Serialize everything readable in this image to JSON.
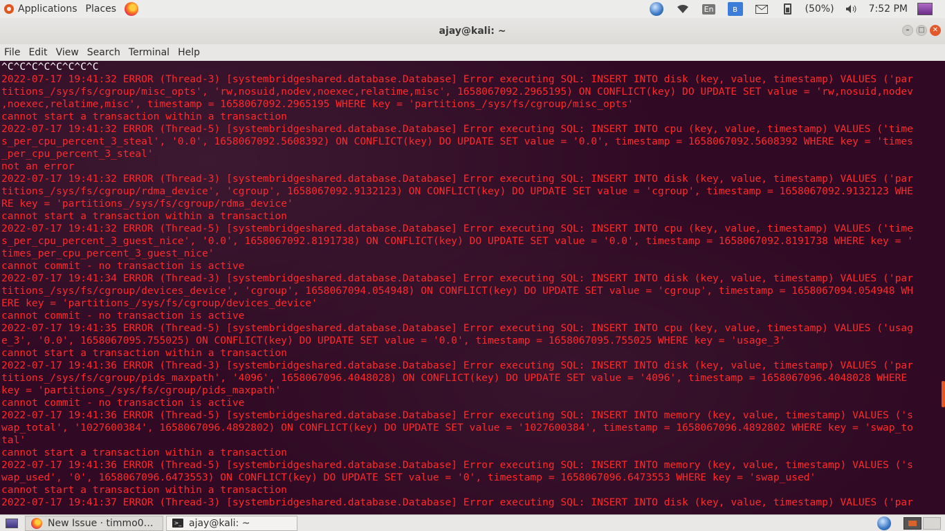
{
  "top_panel": {
    "applications": "Applications",
    "places": "Places",
    "lang": "En",
    "battery": "(50%)",
    "clock": "7:52 PM"
  },
  "window": {
    "title": "ajay@kali: ~"
  },
  "menu": [
    "File",
    "Edit",
    "View",
    "Search",
    "Terminal",
    "Help"
  ],
  "terminal": {
    "lines": [
      {
        "text": "^C^C^C^C^C^C^C^C",
        "color": "white"
      },
      {
        "text": "2022-07-17 19:41:32 ERROR (Thread-3) [systembridgeshared.database.Database] Error executing SQL: INSERT INTO disk (key, value, timestamp) VALUES ('par",
        "color": "red"
      },
      {
        "text": "titions_/sys/fs/cgroup/misc_opts', 'rw,nosuid,nodev,noexec,relatime,misc', 1658067092.2965195) ON CONFLICT(key) DO UPDATE SET value = 'rw,nosuid,nodev",
        "color": "red"
      },
      {
        "text": ",noexec,relatime,misc', timestamp = 1658067092.2965195 WHERE key = 'partitions_/sys/fs/cgroup/misc_opts'",
        "color": "red"
      },
      {
        "text": "cannot start a transaction within a transaction",
        "color": "red"
      },
      {
        "text": "2022-07-17 19:41:32 ERROR (Thread-5) [systembridgeshared.database.Database] Error executing SQL: INSERT INTO cpu (key, value, timestamp) VALUES ('time",
        "color": "red"
      },
      {
        "text": "s_per_cpu_percent_3_steal', '0.0', 1658067092.5608392) ON CONFLICT(key) DO UPDATE SET value = '0.0', timestamp = 1658067092.5608392 WHERE key = 'times",
        "color": "red"
      },
      {
        "text": "_per_cpu_percent_3_steal'",
        "color": "red"
      },
      {
        "text": "not an error",
        "color": "red"
      },
      {
        "text": "2022-07-17 19:41:32 ERROR (Thread-3) [systembridgeshared.database.Database] Error executing SQL: INSERT INTO disk (key, value, timestamp) VALUES ('par",
        "color": "red"
      },
      {
        "text": "titions_/sys/fs/cgroup/rdma_device', 'cgroup', 1658067092.9132123) ON CONFLICT(key) DO UPDATE SET value = 'cgroup', timestamp = 1658067092.9132123 WHE",
        "color": "red"
      },
      {
        "text": "RE key = 'partitions_/sys/fs/cgroup/rdma_device'",
        "color": "red"
      },
      {
        "text": "cannot start a transaction within a transaction",
        "color": "red"
      },
      {
        "text": "2022-07-17 19:41:32 ERROR (Thread-5) [systembridgeshared.database.Database] Error executing SQL: INSERT INTO cpu (key, value, timestamp) VALUES ('time",
        "color": "red"
      },
      {
        "text": "s_per_cpu_percent_3_guest_nice', '0.0', 1658067092.8191738) ON CONFLICT(key) DO UPDATE SET value = '0.0', timestamp = 1658067092.8191738 WHERE key = '",
        "color": "red"
      },
      {
        "text": "times_per_cpu_percent_3_guest_nice'",
        "color": "red"
      },
      {
        "text": "cannot commit - no transaction is active",
        "color": "red"
      },
      {
        "text": "2022-07-17 19:41:34 ERROR (Thread-3) [systembridgeshared.database.Database] Error executing SQL: INSERT INTO disk (key, value, timestamp) VALUES ('par",
        "color": "red"
      },
      {
        "text": "titions_/sys/fs/cgroup/devices_device', 'cgroup', 1658067094.054948) ON CONFLICT(key) DO UPDATE SET value = 'cgroup', timestamp = 1658067094.054948 WH",
        "color": "red"
      },
      {
        "text": "ERE key = 'partitions_/sys/fs/cgroup/devices_device'",
        "color": "red"
      },
      {
        "text": "cannot commit - no transaction is active",
        "color": "red"
      },
      {
        "text": "2022-07-17 19:41:35 ERROR (Thread-5) [systembridgeshared.database.Database] Error executing SQL: INSERT INTO cpu (key, value, timestamp) VALUES ('usag",
        "color": "red"
      },
      {
        "text": "e_3', '0.0', 1658067095.755025) ON CONFLICT(key) DO UPDATE SET value = '0.0', timestamp = 1658067095.755025 WHERE key = 'usage_3'",
        "color": "red"
      },
      {
        "text": "cannot start a transaction within a transaction",
        "color": "red"
      },
      {
        "text": "2022-07-17 19:41:36 ERROR (Thread-3) [systembridgeshared.database.Database] Error executing SQL: INSERT INTO disk (key, value, timestamp) VALUES ('par",
        "color": "red"
      },
      {
        "text": "titions_/sys/fs/cgroup/pids_maxpath', '4096', 1658067096.4048028) ON CONFLICT(key) DO UPDATE SET value = '4096', timestamp = 1658067096.4048028 WHERE",
        "color": "red"
      },
      {
        "text": "key = 'partitions_/sys/fs/cgroup/pids_maxpath'",
        "color": "red"
      },
      {
        "text": "cannot commit - no transaction is active",
        "color": "red"
      },
      {
        "text": "2022-07-17 19:41:36 ERROR (Thread-5) [systembridgeshared.database.Database] Error executing SQL: INSERT INTO memory (key, value, timestamp) VALUES ('s",
        "color": "red"
      },
      {
        "text": "wap_total', '1027600384', 1658067096.4892802) ON CONFLICT(key) DO UPDATE SET value = '1027600384', timestamp = 1658067096.4892802 WHERE key = 'swap_to",
        "color": "red"
      },
      {
        "text": "tal'",
        "color": "red"
      },
      {
        "text": "cannot start a transaction within a transaction",
        "color": "red"
      },
      {
        "text": "2022-07-17 19:41:36 ERROR (Thread-5) [systembridgeshared.database.Database] Error executing SQL: INSERT INTO memory (key, value, timestamp) VALUES ('s",
        "color": "red"
      },
      {
        "text": "wap_used', '0', 1658067096.6473553) ON CONFLICT(key) DO UPDATE SET value = '0', timestamp = 1658067096.6473553 WHERE key = 'swap_used'",
        "color": "red"
      },
      {
        "text": "cannot start a transaction within a transaction",
        "color": "red"
      },
      {
        "text": "2022-07-17 19:41:37 ERROR (Thread-3) [systembridgeshared.database.Database] Error executing SQL: INSERT INTO disk (key, value, timestamp) VALUES ('par",
        "color": "red"
      }
    ]
  },
  "taskbar": {
    "items": [
      {
        "label": "New Issue · timmo00...",
        "icon": "firefox-icon"
      },
      {
        "label": "ajay@kali: ~",
        "icon": "terminal-icon"
      }
    ]
  },
  "colors": {
    "terminal_bg": "#300a24",
    "error_text": "#ff2a2a",
    "accent": "#e95420"
  }
}
